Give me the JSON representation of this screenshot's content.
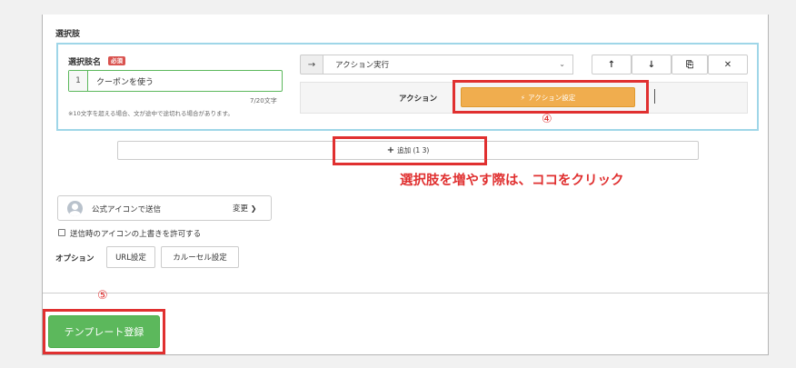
{
  "section": {
    "title": "選択肢"
  },
  "choice": {
    "name_label": "選択肢名",
    "required_badge": "必須",
    "index": "1",
    "name_value": "クーポンを使う",
    "char_count": "7/20文字",
    "note": "※10文字を超える場合、文が途中で途切れる場合があります。"
  },
  "action": {
    "arrow_icon": "→",
    "select_value": "アクション実行",
    "select_chevron": "⌄",
    "row_label": "アクション",
    "button_icon": "⚡",
    "button_label": "アクション設定"
  },
  "toolbar": {
    "up": "↑",
    "down": "↓",
    "copy": "⎘",
    "delete": "✕"
  },
  "add": {
    "plus": "+",
    "label": "追加 (1 3)"
  },
  "annotations": {
    "step4": "④",
    "step5": "⑤",
    "callout": "選択肢を増やす際は、ココをクリック"
  },
  "icon_card": {
    "label": "公式アイコンで送信",
    "change_label": "変更",
    "change_chevron": "❯"
  },
  "overwrite": {
    "label": "送信時のアイコンの上書きを許可する"
  },
  "options": {
    "label": "オプション",
    "url_button": "URL設定",
    "carousel_button": "カルーセル設定"
  },
  "template": {
    "button_label": "テンプレート登録"
  },
  "colors": {
    "accent_orange": "#f0ad4e",
    "accent_green": "#5cb85c",
    "annotation_red": "#e03030",
    "required_red": "#d9534f",
    "highlight_blue": "#9fd6e8"
  },
  "icons": [
    "arrow-right-icon",
    "arrow-up-icon",
    "arrow-down-icon",
    "copy-icon",
    "close-icon",
    "lightning-icon",
    "plus-icon",
    "avatar-icon",
    "chevron-right-icon"
  ]
}
